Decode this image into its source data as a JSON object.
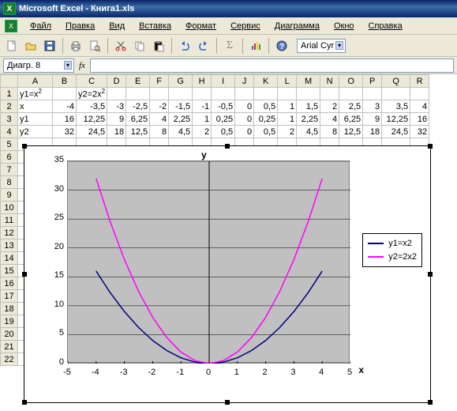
{
  "title": "Microsoft Excel - Книга1.xls",
  "menu": [
    "Файл",
    "Правка",
    "Вид",
    "Вставка",
    "Формат",
    "Сервис",
    "Диаграмма",
    "Окно",
    "Справка"
  ],
  "font": "Arial Cyr",
  "namebox": "Диагр. 8",
  "fx_label": "fx",
  "cols": [
    "A",
    "B",
    "C",
    "D",
    "E",
    "F",
    "G",
    "H",
    "I",
    "J",
    "K",
    "L",
    "M",
    "N",
    "O",
    "P",
    "Q",
    "R"
  ],
  "cells": {
    "A1": "y1=x²",
    "C1": "y2=2x²",
    "A2": "x",
    "A3": "y1",
    "A4": "y2",
    "r2": [
      "-4",
      "-3,5",
      "-3",
      "-2,5",
      "-2",
      "-1,5",
      "-1",
      "-0,5",
      "0",
      "0,5",
      "1",
      "1,5",
      "2",
      "2,5",
      "3",
      "3,5",
      "4"
    ],
    "r3": [
      "16",
      "12,25",
      "9",
      "6,25",
      "4",
      "2,25",
      "1",
      "0,25",
      "0",
      "0,25",
      "1",
      "2,25",
      "4",
      "6,25",
      "9",
      "12,25",
      "16"
    ],
    "r4": [
      "32",
      "24,5",
      "18",
      "12,5",
      "8",
      "4,5",
      "2",
      "0,5",
      "0",
      "0,5",
      "2",
      "4,5",
      "8",
      "12,5",
      "18",
      "24,5",
      "32"
    ]
  },
  "legend": {
    "s1": "y1=x2",
    "s2": "y2=2x2"
  },
  "chart_title_y": "y",
  "chart_title_x": "x",
  "chart_data": {
    "type": "line",
    "x": [
      -4,
      -3.5,
      -3,
      -2.5,
      -2,
      -1.5,
      -1,
      -0.5,
      0,
      0.5,
      1,
      1.5,
      2,
      2.5,
      3,
      3.5,
      4
    ],
    "series": [
      {
        "name": "y1=x2",
        "color": "#000080",
        "values": [
          16,
          12.25,
          9,
          6.25,
          4,
          2.25,
          1,
          0.25,
          0,
          0.25,
          1,
          2.25,
          4,
          6.25,
          9,
          12.25,
          16
        ]
      },
      {
        "name": "y2=2x2",
        "color": "#ff00ff",
        "values": [
          32,
          24.5,
          18,
          12.5,
          8,
          4.5,
          2,
          0.5,
          0,
          0.5,
          2,
          4.5,
          8,
          12.5,
          18,
          24.5,
          32
        ]
      }
    ],
    "ylim": [
      0,
      35
    ],
    "xlim": [
      -5,
      5
    ],
    "yticks": [
      0,
      5,
      10,
      15,
      20,
      25,
      30,
      35
    ],
    "xticks": [
      -5,
      -4,
      -3,
      -2,
      -1,
      0,
      1,
      2,
      3,
      4,
      5
    ],
    "xlabel": "x",
    "ylabel": "y"
  }
}
